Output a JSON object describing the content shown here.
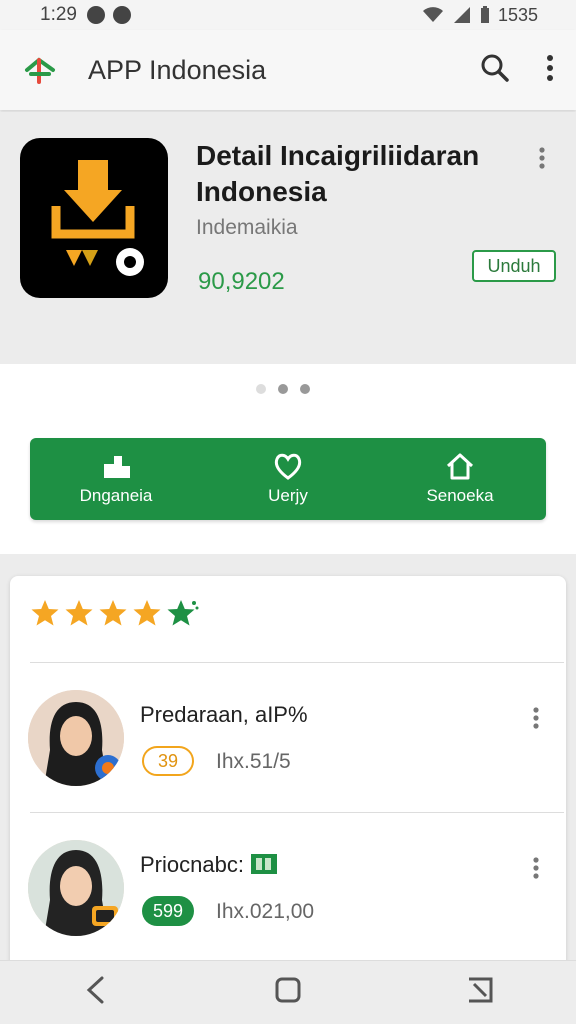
{
  "status": {
    "time": "1:29",
    "battery": "1535"
  },
  "header": {
    "title": "APP Indonesia"
  },
  "app": {
    "name": "Detail Incaigriliidaran Indonesia",
    "developer": "Indemaikia",
    "size": "90,9202",
    "install_label": "Unduh"
  },
  "carousel": {
    "count": 3,
    "active_index": 1
  },
  "actions": [
    {
      "label": "Dnganeia",
      "icon": "building-icon"
    },
    {
      "label": "Uerjy",
      "icon": "heart-icon"
    },
    {
      "label": "Senoeka",
      "icon": "home-icon"
    }
  ],
  "reviews": {
    "rating_stars": 5,
    "items": [
      {
        "name": "Predaraan, aIP%",
        "badge": "39",
        "badge_style": "outline",
        "price": "Ihx.51/5"
      },
      {
        "name": "Priocnabc:",
        "badge": "599",
        "badge_style": "solid",
        "price": "Ihx.021,00"
      }
    ]
  },
  "colors": {
    "brand_green": "#1e9044",
    "accent_orange": "#f2a51c",
    "star_yellow": "#f5a623"
  }
}
